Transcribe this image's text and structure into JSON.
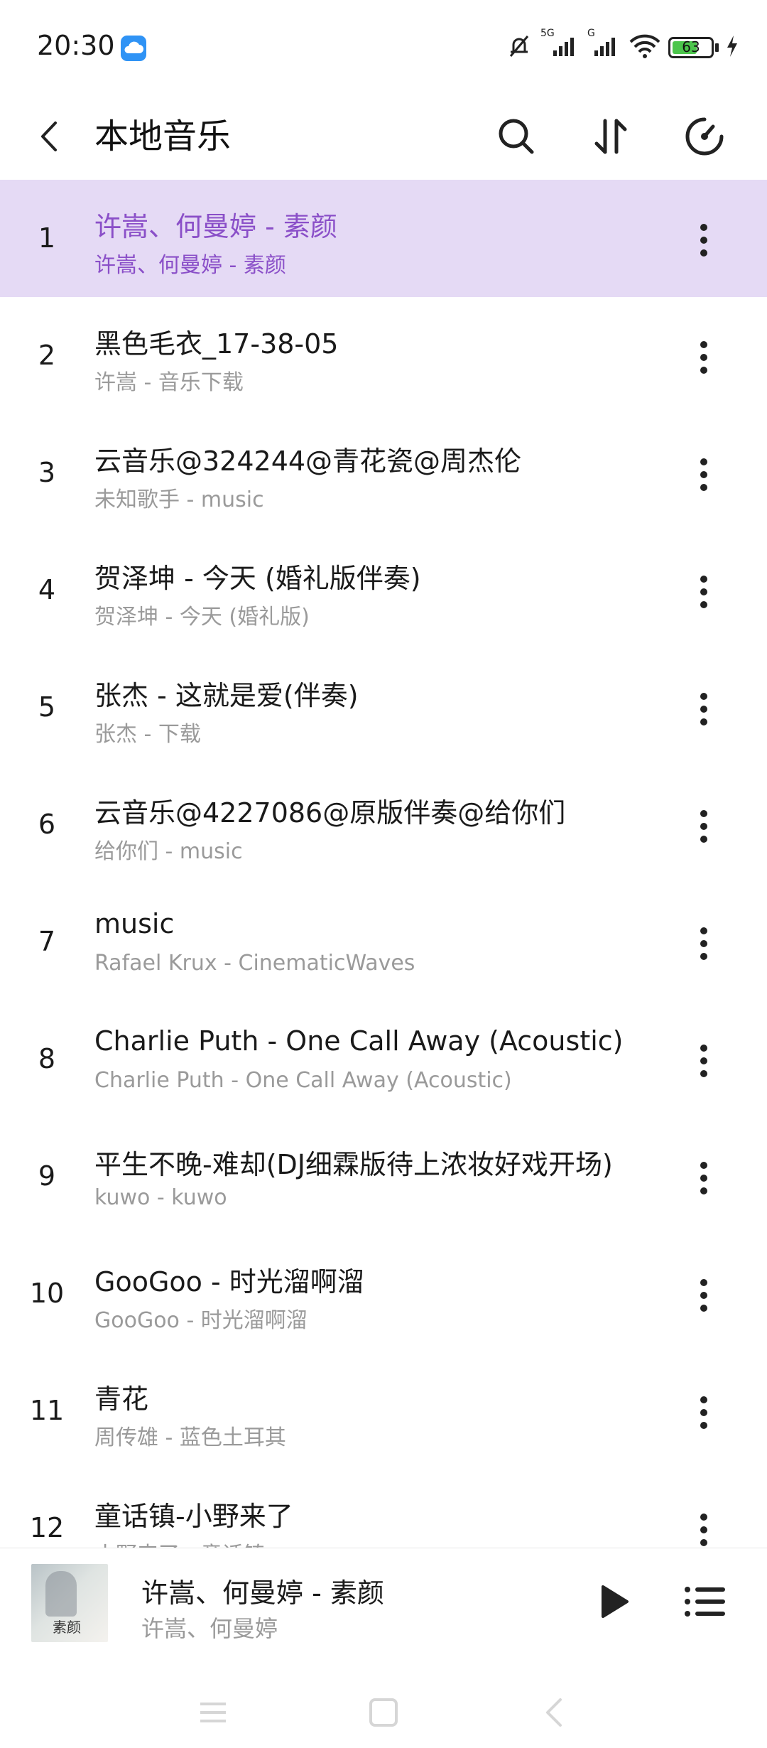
{
  "status_bar": {
    "time": "20:30",
    "network": "5G",
    "network2": "G",
    "battery": "63",
    "icons": [
      "cloud-app-icon",
      "mute-bell-icon",
      "signal-icon",
      "wifi-icon",
      "battery-icon",
      "charging-icon"
    ]
  },
  "header": {
    "title": "本地音乐",
    "icons": [
      "back-icon",
      "search-icon",
      "sort-icon",
      "sleep-timer-icon"
    ]
  },
  "songs": [
    {
      "index": "1",
      "title": "许嵩、何曼婷 - 素颜",
      "subtitle": "许嵩、何曼婷 - 素颜",
      "active": true
    },
    {
      "index": "2",
      "title": "黑色毛衣_17-38-05",
      "subtitle": "许嵩 - 音乐下载"
    },
    {
      "index": "3",
      "title": "云音乐@324244@青花瓷@周杰伦",
      "subtitle": "未知歌手 - music"
    },
    {
      "index": "4",
      "title": "贺泽坤 - 今天 (婚礼版伴奏)",
      "subtitle": "贺泽坤 - 今天 (婚礼版)"
    },
    {
      "index": "5",
      "title": "张杰 - 这就是爱(伴奏)",
      "subtitle": "张杰 - 下载"
    },
    {
      "index": "6",
      "title": "云音乐@4227086@原版伴奏@给你们",
      "subtitle": "给你们 - music"
    },
    {
      "index": "7",
      "title": "music",
      "subtitle": "Rafael Krux - CinematicWaves"
    },
    {
      "index": "8",
      "title": "Charlie Puth - One Call Away (Acoustic)",
      "subtitle": "Charlie Puth - One Call Away (Acoustic)"
    },
    {
      "index": "9",
      "title": "平生不晚-难却(DJ细霖版待上浓妆好戏开场)",
      "subtitle": "kuwo - kuwo"
    },
    {
      "index": "10",
      "title": "GooGoo - 时光溜啊溜",
      "subtitle": "GooGoo - 时光溜啊溜"
    },
    {
      "index": "11",
      "title": "青花",
      "subtitle": "周传雄 - 蓝色土耳其"
    },
    {
      "index": "12",
      "title": "童话镇-小野来了",
      "subtitle": "小野来了 - 童话镇"
    }
  ],
  "player": {
    "title": "许嵩、何曼婷 - 素颜",
    "artist": "许嵩、何曼婷",
    "cover_text": "素颜",
    "icons": [
      "album-cover",
      "play-icon",
      "playlist-icon"
    ]
  },
  "nav_bar": {
    "icons": [
      "menu-icon",
      "home-icon",
      "back-icon"
    ]
  },
  "colors": {
    "active_row_bg": "#e5daf5",
    "active_text": "#8a4fc8",
    "secondary_text": "#9a9a9a",
    "primary_text": "#1a1a1a"
  }
}
